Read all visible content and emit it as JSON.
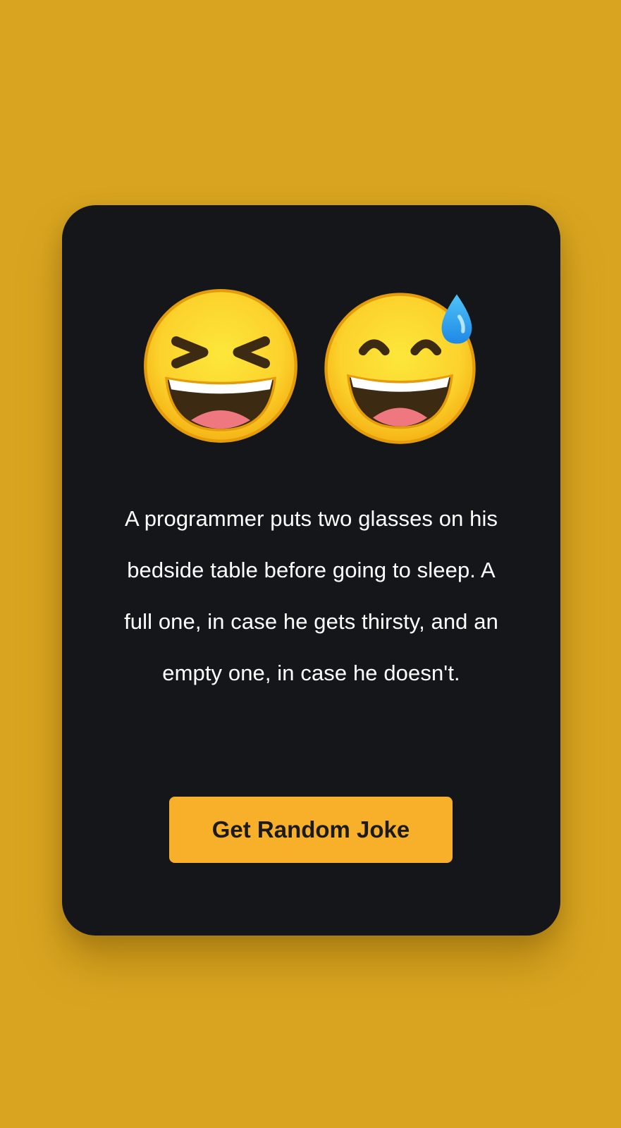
{
  "joke": {
    "text": "A programmer puts two glasses on his bedside table before going to sleep. A full one, in case he gets thirsty, and an empty one, in case he doesn't."
  },
  "emojis": [
    {
      "name": "grinning-squinting-face"
    },
    {
      "name": "grinning-face-with-sweat"
    }
  ],
  "button": {
    "label": "Get Random Joke"
  },
  "colors": {
    "background": "#D9A520",
    "card": "#15161A",
    "button": "#F8AF29",
    "button_text": "#1B1B1B",
    "text": "#FFFFFF"
  }
}
